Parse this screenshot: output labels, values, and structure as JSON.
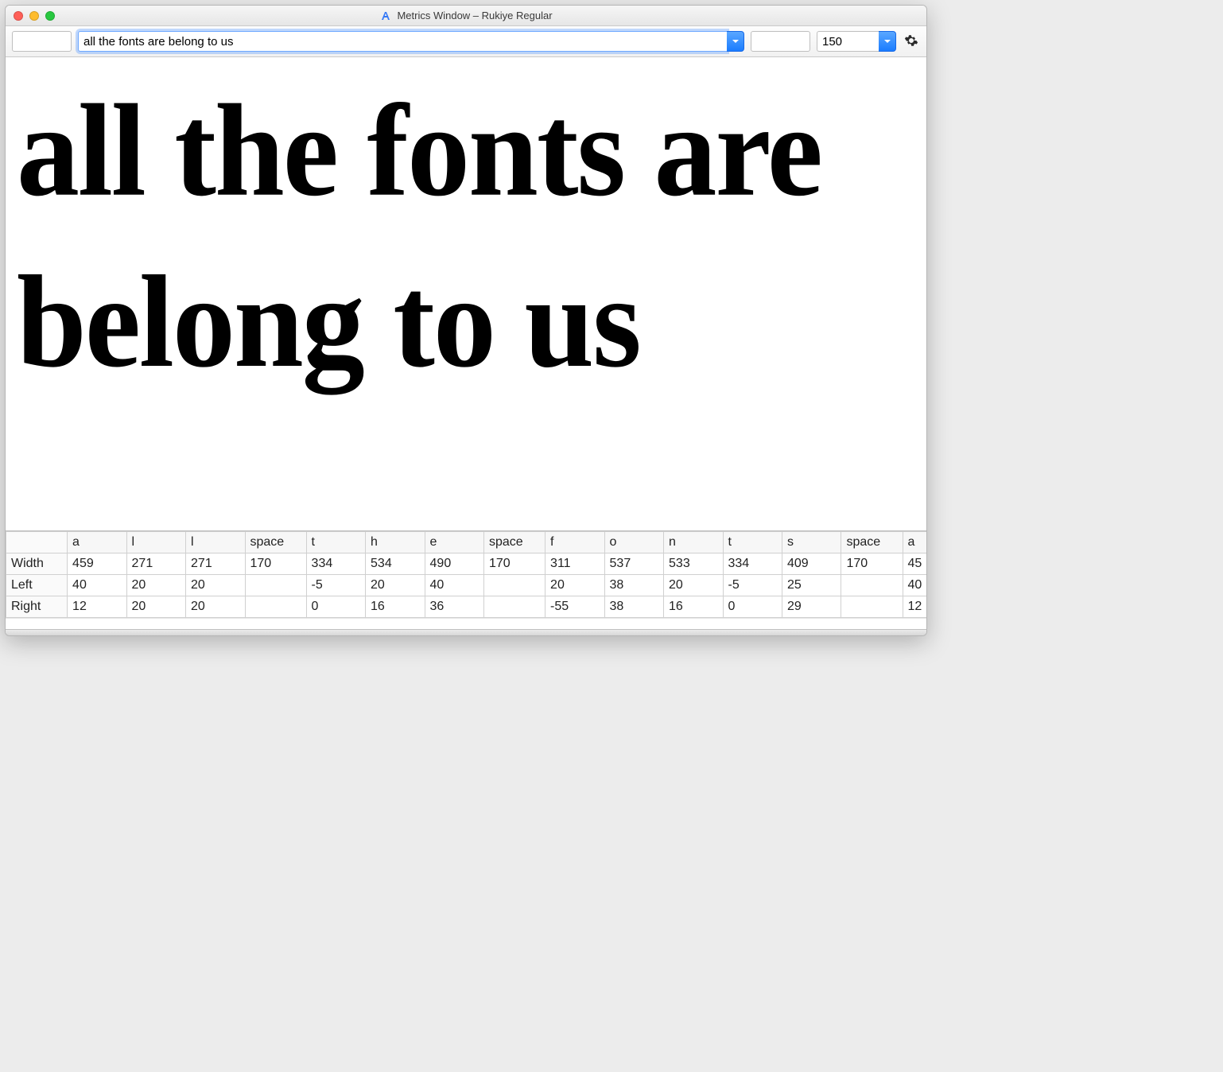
{
  "window": {
    "title": "Metrics Window – Rukiye Regular"
  },
  "toolbar": {
    "left_field_value": "",
    "text_input_value": "all the fonts are belong to us",
    "right_field_value": "",
    "size_value": "150"
  },
  "preview": {
    "text": "all the fonts are belong to us"
  },
  "metrics": {
    "row_labels": [
      "Width",
      "Left",
      "Right"
    ],
    "columns": [
      {
        "glyph": "a",
        "width": "459",
        "left": "40",
        "right": "12"
      },
      {
        "glyph": "l",
        "width": "271",
        "left": "20",
        "right": "20"
      },
      {
        "glyph": "l",
        "width": "271",
        "left": "20",
        "right": "20"
      },
      {
        "glyph": "space",
        "width": "170",
        "left": "",
        "right": ""
      },
      {
        "glyph": "t",
        "width": "334",
        "left": "-5",
        "right": "0"
      },
      {
        "glyph": "h",
        "width": "534",
        "left": "20",
        "right": "16"
      },
      {
        "glyph": "e",
        "width": "490",
        "left": "40",
        "right": "36"
      },
      {
        "glyph": "space",
        "width": "170",
        "left": "",
        "right": ""
      },
      {
        "glyph": "f",
        "width": "311",
        "left": "20",
        "right": "-55"
      },
      {
        "glyph": "o",
        "width": "537",
        "left": "38",
        "right": "38"
      },
      {
        "glyph": "n",
        "width": "533",
        "left": "20",
        "right": "16"
      },
      {
        "glyph": "t",
        "width": "334",
        "left": "-5",
        "right": "0"
      },
      {
        "glyph": "s",
        "width": "409",
        "left": "25",
        "right": "29"
      },
      {
        "glyph": "space",
        "width": "170",
        "left": "",
        "right": ""
      },
      {
        "glyph": "a",
        "width": "45",
        "left": "40",
        "right": "12"
      }
    ]
  }
}
